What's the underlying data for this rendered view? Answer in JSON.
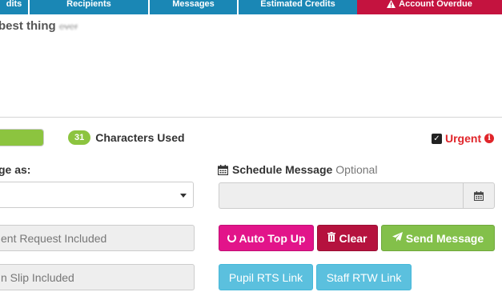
{
  "topbar": {
    "tabs": [
      {
        "label": "dits"
      },
      {
        "label": "Recipients"
      },
      {
        "label": "Messages"
      },
      {
        "label": "Estimated Credits"
      },
      {
        "label": "Account Overdue"
      }
    ],
    "colors": {
      "tab": "#1a87b5",
      "overdue": "#c4133f"
    }
  },
  "message": {
    "text": "best thing",
    "blurred_text": "ever"
  },
  "progress": {
    "fill_fraction": 1.0
  },
  "characters": {
    "count": "31",
    "label": "Characters Used"
  },
  "urgent": {
    "label": "Urgent",
    "checked": true,
    "info_icon": "info-circle-icon"
  },
  "send_as": {
    "label": "ge as:",
    "selected": ""
  },
  "fields": {
    "consent": "ent Request Included",
    "slip": "n Slip Included"
  },
  "schedule": {
    "title": "Schedule Message",
    "optional": "Optional",
    "value": "",
    "icon": "calendar-icon"
  },
  "buttons": {
    "topup": "Auto Top Up",
    "clear": "Clear",
    "send": "Send Message",
    "pupil": "Pupil RTS Link",
    "staff": "Staff RTW Link"
  },
  "colors": {
    "green": "#8cc43f",
    "pink": "#e2148a",
    "maroon": "#b5123e",
    "info": "#5bc0de",
    "urgent": "#e0252a"
  }
}
